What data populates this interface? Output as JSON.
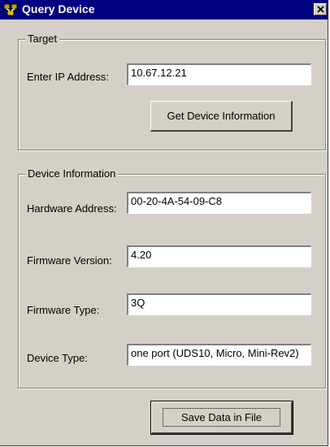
{
  "window": {
    "title": "Query Device",
    "icon": "network-device-icon",
    "close": "×"
  },
  "target_group": {
    "legend": "Target",
    "ip_label": "Enter IP Address:",
    "ip_value": "10.67.12.21",
    "get_info_button": "Get Device Information"
  },
  "device_group": {
    "legend": "Device Information",
    "hardware_label": "Hardware Address:",
    "hardware_value": "00-20-4A-54-09-C8",
    "firmware_version_label": "Firmware Version:",
    "firmware_version_value": "4.20",
    "firmware_type_label": "Firmware Type:",
    "firmware_type_value": "3Q",
    "device_type_label": "Device Type:",
    "device_type_value": "one port (UDS10, Micro, Mini-Rev2)"
  },
  "save_button": "Save Data in File"
}
